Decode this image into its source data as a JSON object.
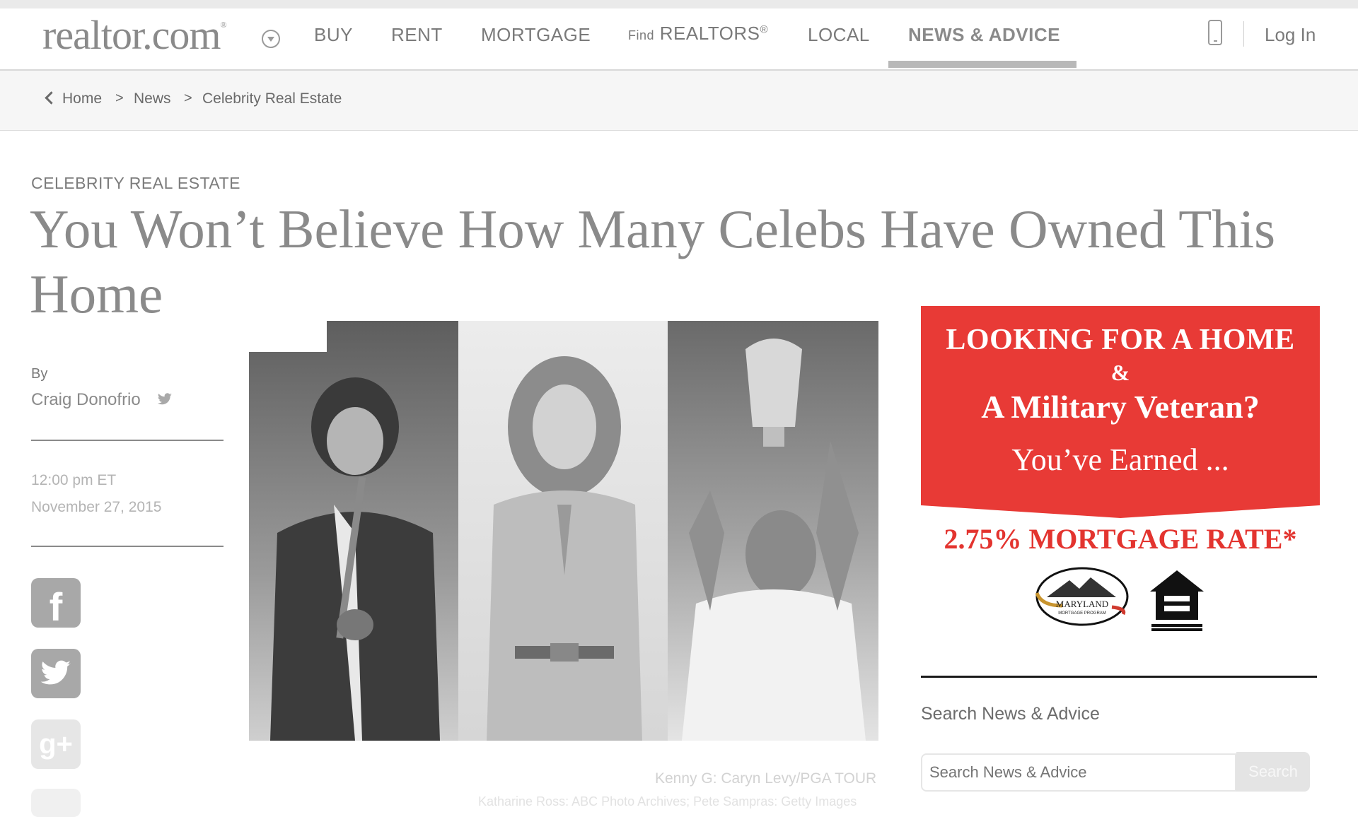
{
  "header": {
    "logo_text": "realtor.com",
    "logo_mark": "®",
    "nav": [
      {
        "label": "BUY"
      },
      {
        "label": "RENT"
      },
      {
        "label": "MORTGAGE"
      },
      {
        "prefix": "Find",
        "label": "REALTORS",
        "mark": "®"
      },
      {
        "label": "LOCAL"
      },
      {
        "label": "NEWS & ADVICE",
        "active": true
      }
    ],
    "login_label": "Log In"
  },
  "breadcrumb": {
    "items": [
      "Home",
      "News",
      "Celebrity Real Estate"
    ],
    "separator": ">"
  },
  "article": {
    "category": "CELEBRITY REAL ESTATE",
    "headline": "You Won’t Believe How Many Celebs Have Owned This Home",
    "byline_label": "By",
    "author": "Craig Donofrio",
    "time": "12:00 pm ET",
    "date": "November 27, 2015",
    "share_icons": [
      "facebook-icon",
      "twitter-icon",
      "google-plus-icon"
    ],
    "photo_credit": "Kenny G: Caryn Levy/PGA TOUR",
    "photo_credit_2": "Katharine Ross: ABC Photo Archives; Pete Sampras: Getty Images"
  },
  "ad": {
    "line1": "LOOKING FOR A HOME",
    "line2": "&",
    "line3": "A  Military Veteran?",
    "line4": "You’ve Earned ...",
    "rate": "2.75% MORTGAGE RATE*",
    "logo1_text": "MARYLAND",
    "logo1_subtext": "MORTGAGE PROGRAM",
    "accent_color": "#e83a36"
  },
  "sidebar": {
    "search_title": "Search News & Advice",
    "search_placeholder": "Search News & Advice",
    "search_button": "Search"
  }
}
